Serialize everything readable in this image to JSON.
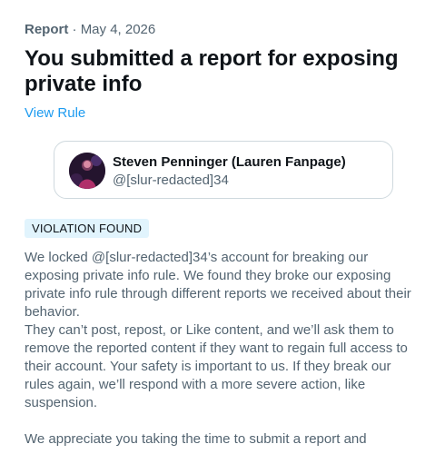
{
  "report": {
    "kind": "Report",
    "separator": " · ",
    "date": "May 4, 2026",
    "title": "You submitted a report for exposing private info",
    "rule_link": "View Rule"
  },
  "account": {
    "name": "Steven Penninger (Lauren Fanpage)",
    "handle": "@[slur-redacted]34"
  },
  "status": {
    "badge": "VIOLATION FOUND",
    "badge_bg": "#e1f4fd"
  },
  "body": {
    "paragraph_1": "We locked @[slur-redacted]34’s account for breaking our exposing private info rule. We found they broke our exposing private info rule through different reports we received about their behavior.",
    "paragraph_2": "They can’t post, repost, or Like content, and we’ll ask them to remove the reported content if they want to regain full access to their account. Your safety is important to us. If they break our rules again, we’ll respond with a more severe action, like suspension.",
    "paragraph_3": "We appreciate you taking the time to submit a report and"
  },
  "colors": {
    "text_primary": "#0f1419",
    "text_secondary": "#536471",
    "link": "#1d9bf0",
    "card_border": "#cfd9de"
  }
}
